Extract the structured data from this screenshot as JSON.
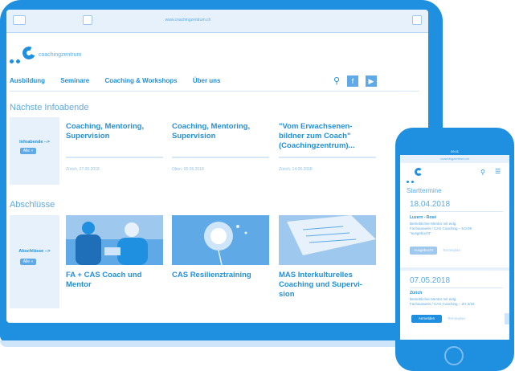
{
  "browser": {
    "url": "www.coachingzentrum.ch"
  },
  "logo": {
    "text": "coachingzentrum"
  },
  "nav": {
    "items": [
      "Ausbildung",
      "Seminare",
      "Coaching & Workshops",
      "Über uns"
    ]
  },
  "icons": {
    "search": "search-icon",
    "facebook": "facebook-icon",
    "youtube": "youtube-icon"
  },
  "infoabende": {
    "title": "Nächste Infoabende",
    "side_label": "Infoabende -->",
    "side_button": "Alle »",
    "cards": [
      {
        "title": "Coaching, Mentoring, Supervision",
        "meta": "Zürich, 27.05.2018"
      },
      {
        "title": "Coaching, Mentoring, Supervision",
        "meta": "Olten, 05.06.2018"
      },
      {
        "title": "\"Vom Erwachsenen-bildner zum Coach\" (Coachingzentrum)...",
        "meta": "Zürich, 14.06.2018"
      }
    ]
  },
  "abschluesse": {
    "title": "Abschlüsse",
    "side_label": "Abschlüsse -->",
    "side_button": "Alle »",
    "cards": [
      {
        "title": "FA + CAS Coach und Mentor"
      },
      {
        "title": "CAS Resilienztraining"
      },
      {
        "title": "MAS Interkulturelles Coaching und Supervi-sion"
      }
    ]
  },
  "phone": {
    "status_time": "09:41",
    "url": "coachingzentrum.ch",
    "heading": "Starttermine",
    "events": [
      {
        "date": "18.04.2018",
        "place": "Luzern - Rosé",
        "desc1": "Betrieblicher Mentor mit eidg.",
        "desc2": "Fachausweis / CAS Coaching – 5.0.09",
        "desc3": "\"ausgebucht\"",
        "primary": "Ausgebucht",
        "secondary": "Terminplan"
      },
      {
        "date": "07.05.2018",
        "place": "Zürich",
        "desc1": "Betrieblicher Mentor mit eidg.",
        "desc2": "Fachausweis / CAS Coaching – ZH 2/18",
        "desc3": "",
        "primary": "Anmelden",
        "secondary": "Terminplan"
      }
    ]
  },
  "colors": {
    "accent": "#1f8fe0",
    "light": "#e6f1fb",
    "mid": "#5ea9e6"
  }
}
